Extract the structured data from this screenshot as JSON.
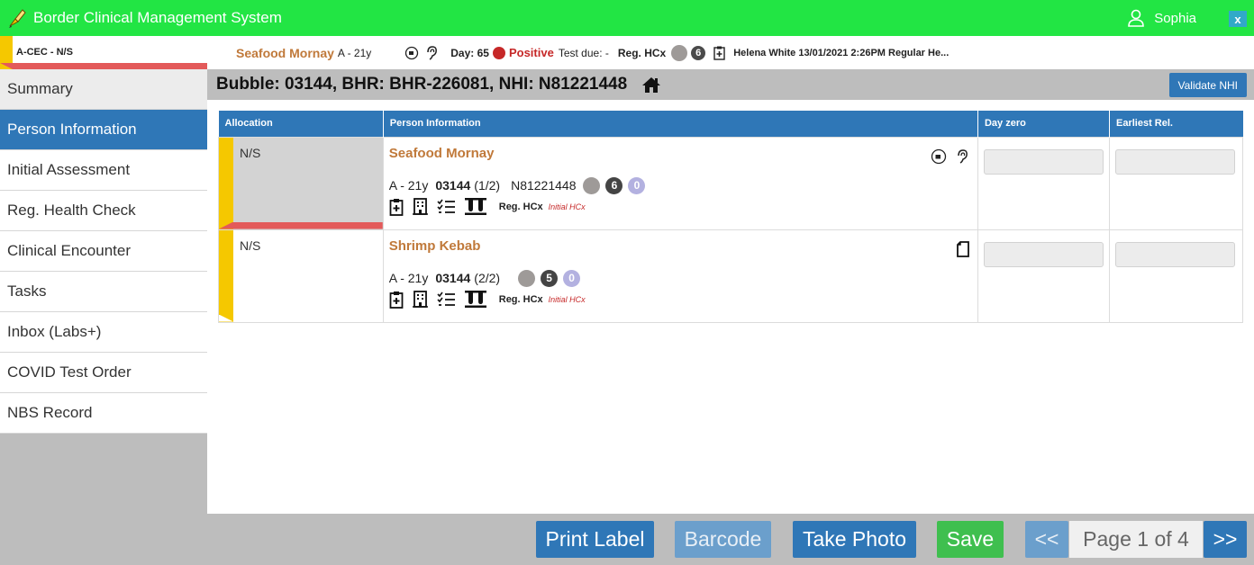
{
  "app": {
    "title": "Border Clinical Management System",
    "user_name": "Sophia",
    "close_label": "x"
  },
  "patient_strip": {
    "location": "A-CEC - N/S",
    "name": "Seafood Mornay",
    "age": "A - 21y",
    "day_label": "Day: 65",
    "status": "Positive",
    "test_due": "Test due: -",
    "reg_hcx": "Reg. HCx",
    "count": "6",
    "last_note": "Helena White 13/01/2021 2:26PM Regular He..."
  },
  "sidebar": {
    "items": [
      {
        "label": "Summary"
      },
      {
        "label": "Person Information"
      },
      {
        "label": "Initial Assessment"
      },
      {
        "label": "Reg. Health Check"
      },
      {
        "label": "Clinical Encounter"
      },
      {
        "label": "Tasks"
      },
      {
        "label": "Inbox (Labs+)"
      },
      {
        "label": "COVID Test Order"
      },
      {
        "label": "NBS Record"
      }
    ]
  },
  "main": {
    "title": "Bubble: 03144, BHR: BHR-226081, NHI: N81221448",
    "validate_label": "Validate NHI",
    "columns": [
      "Allocation",
      "Person Information",
      "Day zero",
      "Earliest Rel."
    ],
    "rows": [
      {
        "allocation": "N/S",
        "name": "Seafood Mornay",
        "age": "A - 21y",
        "bubble": "03144",
        "position": "(1/2)",
        "nhi": "N81221448",
        "count_dark": "6",
        "count_lav": "0",
        "reg_hcx": "Reg. HCx",
        "initial_hcx": "Initial HCx"
      },
      {
        "allocation": "N/S",
        "name": "Shrimp Kebab",
        "age": "A - 21y",
        "bubble": "03144",
        "position": "(2/2)",
        "nhi": "",
        "count_dark": "5",
        "count_lav": "0",
        "reg_hcx": "Reg. HCx",
        "initial_hcx": "Initial HCx"
      }
    ]
  },
  "footer": {
    "print_label": "Print Label",
    "barcode": "Barcode",
    "take_photo": "Take Photo",
    "save": "Save",
    "prev": "<<",
    "page": "Page 1 of 4",
    "next": ">>"
  },
  "colors": {
    "titlebar": "#22e544",
    "primary": "#2f77b7",
    "allocation_yellow": "#f5c800",
    "allocation_red": "#e35a5a",
    "name_orange": "#c0793a",
    "positive_red": "#c62828"
  }
}
